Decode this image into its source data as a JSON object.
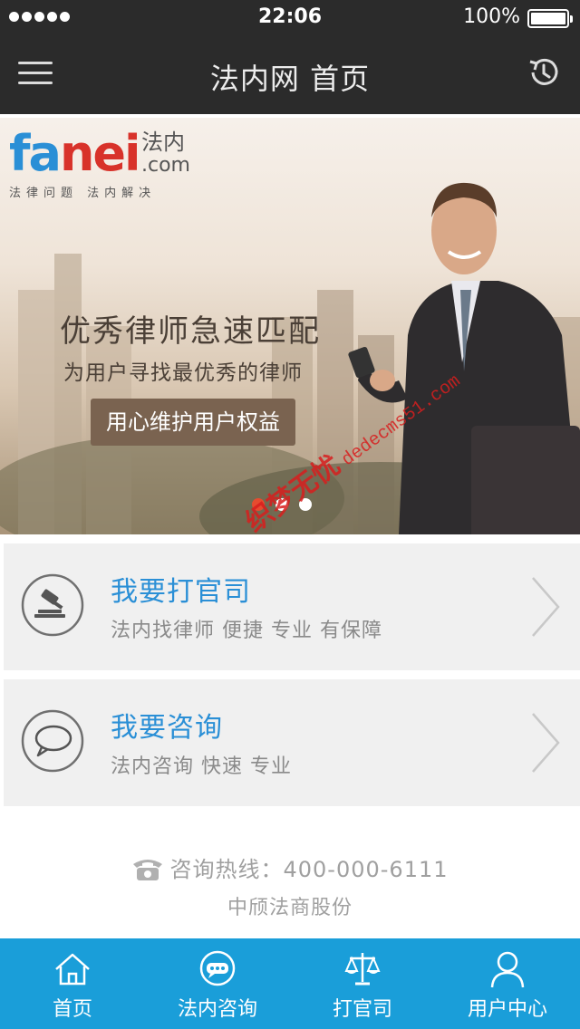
{
  "status_bar": {
    "time": "22:06",
    "battery": "100%"
  },
  "nav": {
    "title": "法内网 首页"
  },
  "banner": {
    "logo": {
      "fa": "fa",
      "nei": "nei",
      "cn": "法内",
      "com": ".com",
      "tagline": "法律问题 法内解决"
    },
    "headline": "优秀律师急速匹配",
    "subtitle": "为用户寻找最优秀的律师",
    "cta": "用心维护用户权益",
    "slides": 3,
    "active_slide": 1
  },
  "watermark": {
    "cn": "织梦无忧",
    "url": "dedecms51.com"
  },
  "cards": [
    {
      "title": "我要打官司",
      "desc": "法内找律师 便捷 专业 有保障"
    },
    {
      "title": "我要咨询",
      "desc": "法内咨询 快速 专业"
    }
  ],
  "footer": {
    "hotline": "咨询热线：400-000-6111",
    "company": "中颀法商股份"
  },
  "tabs": [
    {
      "label": "首页",
      "icon": "home-icon"
    },
    {
      "label": "法内咨询",
      "icon": "chat-icon"
    },
    {
      "label": "打官司",
      "icon": "scales-icon"
    },
    {
      "label": "用户中心",
      "icon": "user-icon"
    }
  ],
  "colors": {
    "accent": "#1a9ed9",
    "title_blue": "#2a8fd6",
    "header": "#2b2b2b",
    "card_bg": "#f0f0f0",
    "dot_active": "#e64b2f"
  }
}
